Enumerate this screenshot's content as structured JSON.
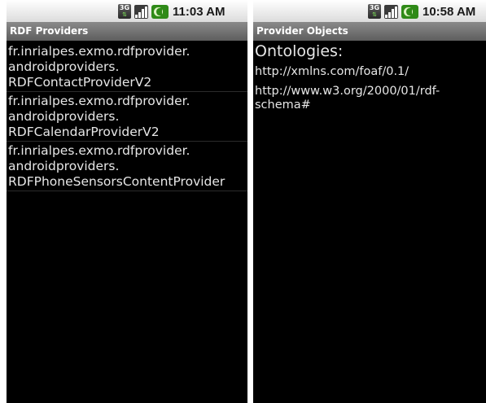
{
  "left_screen": {
    "status": {
      "time": "11:03 AM"
    },
    "title": "RDF Providers",
    "providers": [
      {
        "line1": "fr.inrialpes.exmo.rdfprovider.",
        "line2": "androidproviders.",
        "line3": "RDFContactProviderV2"
      },
      {
        "line1": "fr.inrialpes.exmo.rdfprovider.",
        "line2": "androidproviders.",
        "line3": "RDFCalendarProviderV2"
      },
      {
        "line1": "fr.inrialpes.exmo.rdfprovider.",
        "line2": "androidproviders.",
        "line3": "RDFPhoneSensorsContentProvider"
      }
    ]
  },
  "right_screen": {
    "status": {
      "time": "10:58 AM"
    },
    "title": "Provider Objects",
    "heading": "Ontologies:",
    "ontologies": [
      {
        "line1": "http://xmlns.com/foaf/0.1/",
        "line2": ""
      },
      {
        "line1": "http://www.w3.org/2000/01/rdf-",
        "line2": "schema#"
      }
    ]
  },
  "icons": {
    "network": "3g-data-icon",
    "signal": "signal-strength-icon",
    "battery": "battery-charging-icon"
  },
  "colors": {
    "status_bar": "#e6e6e6",
    "title_bar": "#707070",
    "background": "#000000",
    "text": "#e6e6e6",
    "battery": "#2f8a18"
  }
}
